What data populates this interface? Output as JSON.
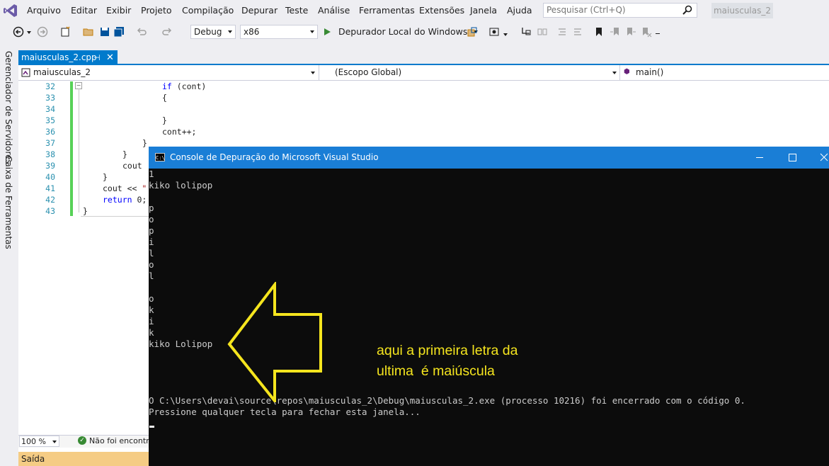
{
  "menu": {
    "items": [
      "Arquivo",
      "Editar",
      "Exibir",
      "Projeto",
      "Compilação",
      "Depurar",
      "Teste",
      "Análise",
      "Ferramentas",
      "Extensões",
      "Janela",
      "Ajuda"
    ],
    "search_placeholder": "Pesquisar (Ctrl+Q)",
    "solution_name": "maiusculas_2"
  },
  "toolbar": {
    "config": "Debug",
    "platform": "x86",
    "run_label": "Depurador Local do Windows"
  },
  "side_panels": [
    "Gerenciador de Servidores",
    "Caixa de Ferramentas"
  ],
  "editor": {
    "tab_label": "maiusculas_2.cpp",
    "nav_project": "maiusculas_2",
    "nav_scope": "(Escopo Global)",
    "nav_function": "main()",
    "line_numbers": [
      "32",
      "33",
      "34",
      "35",
      "36",
      "37",
      "38",
      "39",
      "40",
      "41",
      "42",
      "43"
    ],
    "code": {
      "l32_kw": "if",
      "l32_rest": " (cont)",
      "l33": "{",
      "l35": "}",
      "l36": "cont++;",
      "l37": "}",
      "l38": "}",
      "l39": "cout",
      "l40": "}",
      "l41_a": "cout << ",
      "l41_str": "\"",
      "l42_kw": "return",
      "l42_rest": " 0;",
      "l43": "}"
    },
    "zoom": "100 %",
    "issues_text": "Não foi encontra",
    "output_label": "Saída"
  },
  "console": {
    "title": "Console de Depuração do Microsoft Visual Studio",
    "icon_label": "C:\\",
    "lines": [
      "1",
      "kiko lolipop",
      "",
      "p",
      "o",
      "p",
      "i",
      "l",
      "o",
      "l",
      "",
      "o",
      "k",
      "i",
      "k",
      "kiko Lolipop",
      "",
      "",
      "",
      "",
      "O C:\\Users\\devai\\source\\repos\\maiusculas_2\\Debug\\maiusculas_2.exe (processo 10216) foi encerrado com o código 0.",
      "Pressione qualquer tecla para fechar esta janela..."
    ],
    "annotation": "aqui a primeira letra da\nultima  é maiúscula"
  },
  "colors": {
    "accent": "#007acc",
    "console_titlebar": "#1a7ed6",
    "annotation": "#f5e51e",
    "change_bar": "#57d157"
  }
}
